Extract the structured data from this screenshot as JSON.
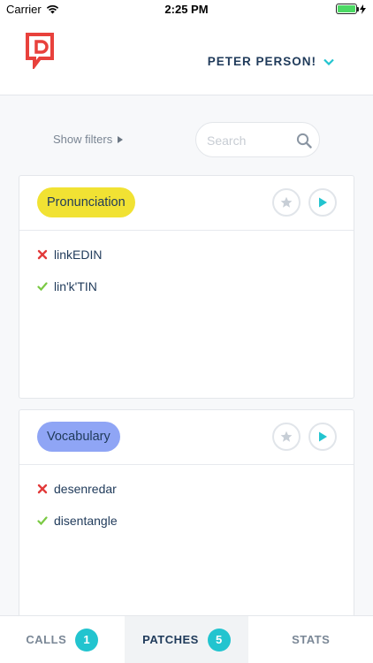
{
  "status_bar": {
    "carrier": "Carrier",
    "time": "2:25 PM"
  },
  "header": {
    "user_name": "PETER PERSON!"
  },
  "filters": {
    "toggle_label": "Show filters"
  },
  "search": {
    "placeholder": "Search"
  },
  "cards": [
    {
      "category": "Pronunciation",
      "category_color": "#f1e233",
      "wrong": "linkEDIN",
      "right": "lin'k'TIN"
    },
    {
      "category": "Vocabulary",
      "category_color": "#8fa5f5",
      "wrong": "desenredar",
      "right": "disentangle"
    }
  ],
  "tabs": [
    {
      "label": "CALLS",
      "count": "1"
    },
    {
      "label": "PATCHES",
      "count": "5",
      "active": true
    },
    {
      "label": "STATS"
    }
  ],
  "colors": {
    "brand_red": "#e8413c",
    "accent_teal": "#22c4cf",
    "wrong_red": "#e23a3a",
    "right_green": "#7ac943"
  }
}
